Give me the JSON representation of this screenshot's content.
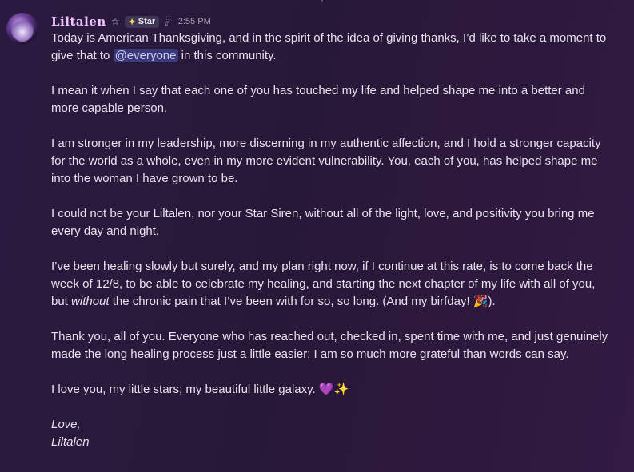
{
  "author": {
    "name": "Liltalen",
    "role_tag": "Star",
    "timestamp": "2:55 PM"
  },
  "message": {
    "p1_a": "Today is American Thanksgiving, and in the spirit of the idea of giving thanks, I’d like to take a moment to give that to ",
    "p1_mention": "@everyone",
    "p1_b": " in this community.",
    "p2": "I mean it when I say that each one of you has touched my life and helped shape me into a better and more capable person.",
    "p3": "I am stronger in my leadership, more discerning in my authentic affection, and I hold a stronger capacity for the world as a whole, even in my more evident vulnerability. You, each of you, has helped shape me into the woman I have grown to be.",
    "p4": "I could not be your Liltalen, nor your Star Siren, without all of the light, love, and positivity you bring me every day and night.",
    "p5_a": "I’ve been healing slowly but surely, and my plan right now, if I continue at this rate, is to come back the week of 12/8, to be able to celebrate my healing, and starting the next chapter of my life with all of you, but ",
    "p5_em": "without",
    "p5_b": " the chronic pain that I’ve been with for so, so long. (And my birfday! ",
    "p5_c": ").",
    "p6": "Thank you, all of you. Everyone who has reached out, checked in, spent time with me, and just genuinely made the long healing process just a little easier; I am so much more grateful than words can say.",
    "p7": "I love you, my little stars; my beautiful little galaxy. ",
    "sig1": "Love,",
    "sig2": "Liltalen"
  },
  "icons": {
    "party_glyph": "🎉",
    "heart_glyph": "💜",
    "sparkle_glyph": "✨",
    "star_outline_glyph": "☆",
    "tag_glyph": "✦",
    "shooting_star_glyph": "☄"
  }
}
